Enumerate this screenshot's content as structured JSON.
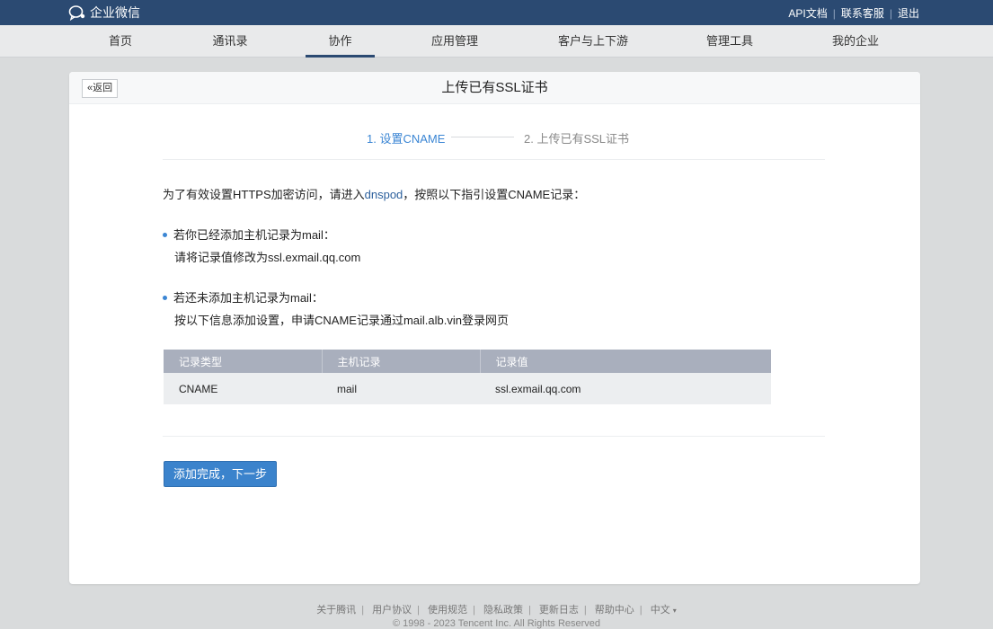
{
  "topbar": {
    "app_name": "企业微信",
    "links": [
      "API文档",
      "联系客服",
      "退出"
    ],
    "background": "#2b4a72"
  },
  "nav": {
    "items": [
      "首页",
      "通讯录",
      "协作",
      "应用管理",
      "客户与上下游",
      "管理工具",
      "我的企业"
    ],
    "active": "协作"
  },
  "card": {
    "back_label": "返回",
    "title": "上传已有SSL证书",
    "steps": {
      "step1": "1. 设置CNAME",
      "step2": "2. 上传已有SSL证书",
      "current": 1
    },
    "intro": {
      "before": "为了有效设置HTTPS加密访问，请进入",
      "link": "dnspod",
      "after": "，按照以下指引设置CNAME记录："
    },
    "case1": {
      "heading": "若你已经添加主机记录为mail：",
      "detail": "请将记录值修改为ssl.exmail.qq.com"
    },
    "case2": {
      "heading": "若还未添加主机记录为mail：",
      "detail": "按以下信息添加设置，申请CNAME记录通过mail.alb.vin登录网页"
    },
    "table": {
      "headers": [
        "记录类型",
        "主机记录",
        "记录值"
      ],
      "rows": [
        [
          "CNAME",
          "mail",
          "ssl.exmail.qq.com"
        ]
      ]
    },
    "next_button": "添加完成，下一步"
  },
  "footer": {
    "links": [
      "关于腾讯",
      "用户协议",
      "使用规范",
      "隐私政策",
      "更新日志",
      "帮助中心",
      "中文"
    ],
    "language_caret": "▾",
    "copyright": "© 1998 - 2023 Tencent Inc. All Rights Reserved"
  },
  "colors": {
    "accent": "#3b86d4",
    "button": "#3b83cc",
    "table_header": "#a9afbd",
    "page_bg": "#d9dbdc"
  },
  "icons": {
    "logo": "chat-bubble-icon",
    "back": "double-chevron-left-icon",
    "language": "caret-down-icon"
  }
}
